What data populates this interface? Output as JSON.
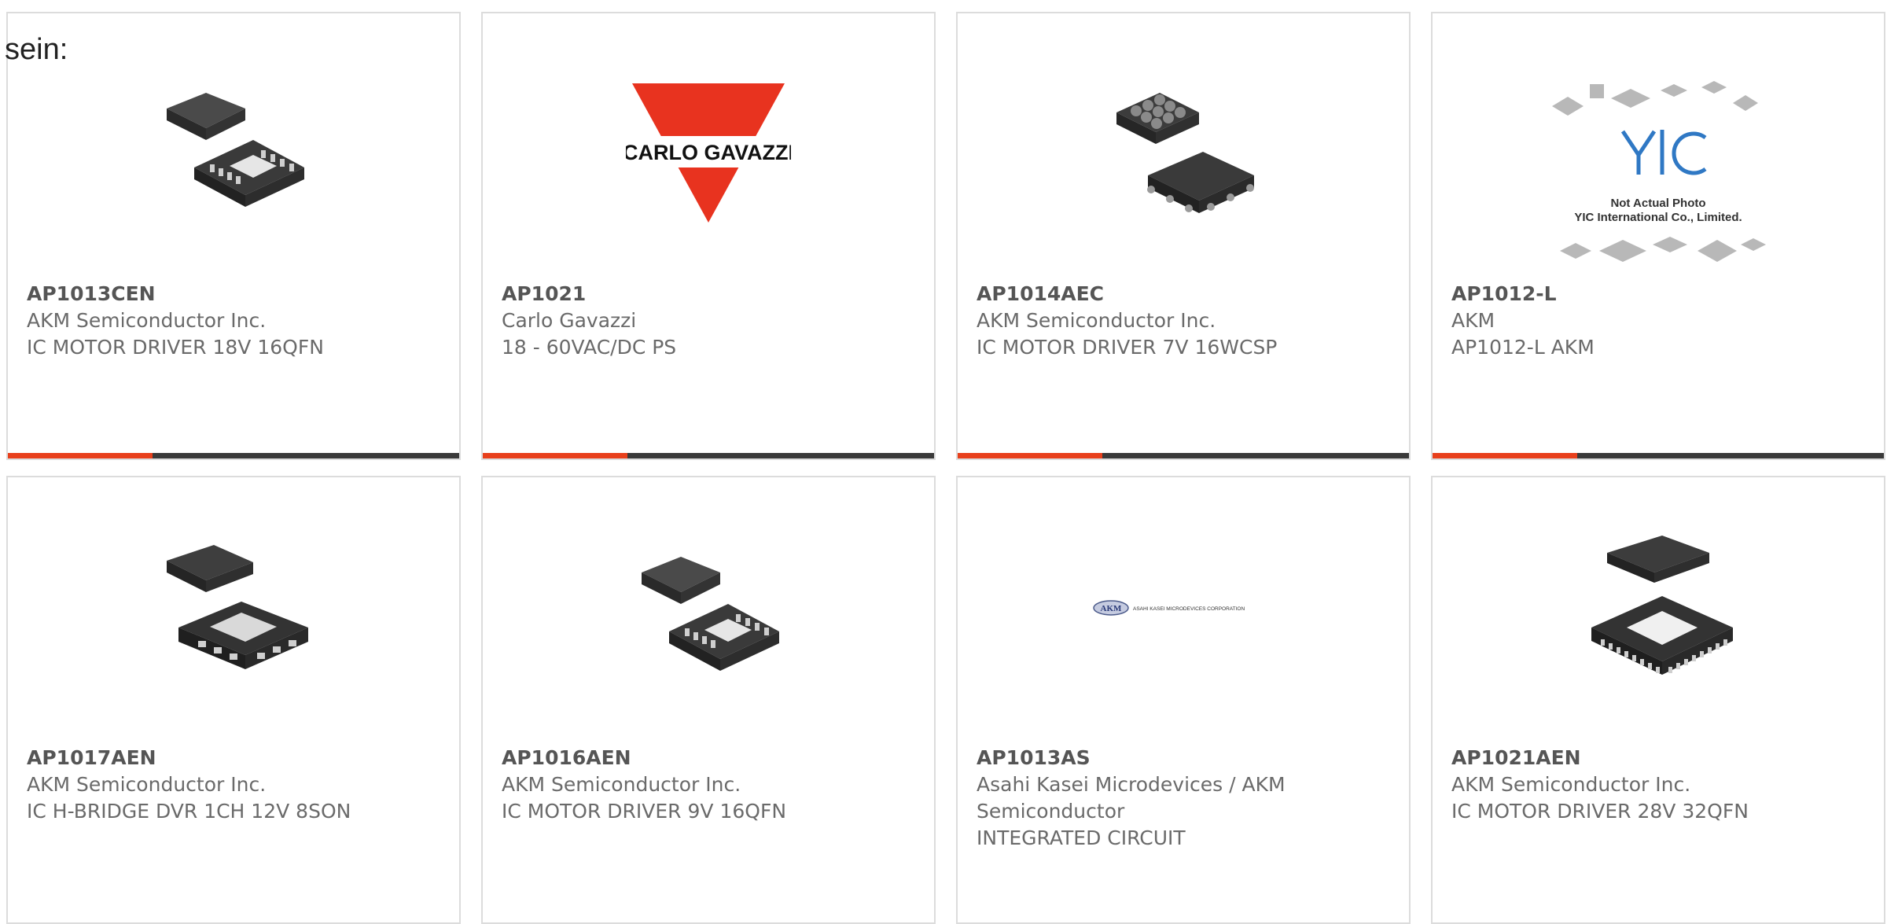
{
  "intro_text": "sein:",
  "colors": {
    "accent": "#e8401c",
    "bar": "#3a3a3a",
    "border": "#dcdcdc",
    "text": "#6a6a6a"
  },
  "cards": [
    {
      "part": "AP1013CEN",
      "maker": "AKM Semiconductor Inc.",
      "desc": "IC MOTOR DRIVER 18V 16QFN",
      "image": "qfn16-chip-icon"
    },
    {
      "part": "AP1021",
      "maker": "Carlo Gavazzi",
      "desc": "18 - 60VAC/DC PS",
      "image": "carlo-gavazzi-logo",
      "logo_text": "CARLO GAVAZZI"
    },
    {
      "part": "AP1014AEC",
      "maker": "AKM Semiconductor Inc.",
      "desc": "IC MOTOR DRIVER 7V 16WCSP",
      "image": "wcsp-chip-icon"
    },
    {
      "part": "AP1012-L",
      "maker": "AKM",
      "desc": "AP1012-L AKM",
      "image": "yic-placeholder",
      "logo_text": "YIC",
      "note1": "Not Actual Photo",
      "note2": "YIC International Co., Limited."
    },
    {
      "part": "AP1017AEN",
      "maker": "AKM Semiconductor Inc.",
      "desc": "IC H-BRIDGE DVR 1CH 12V 8SON",
      "image": "son8-chip-icon"
    },
    {
      "part": "AP1016AEN",
      "maker": "AKM Semiconductor Inc.",
      "desc": "IC MOTOR DRIVER 9V 16QFN",
      "image": "qfn16-chip-icon"
    },
    {
      "part": "AP1013AS",
      "maker": "Asahi Kasei Microdevices / AKM Semiconductor",
      "desc": "INTEGRATED CIRCUIT",
      "image": "akm-logo",
      "logo_text": "AKM",
      "logo_sub": "ASAHI KASEI MICRODEVICES CORPORATION"
    },
    {
      "part": "AP1021AEN",
      "maker": "AKM Semiconductor Inc.",
      "desc": "IC MOTOR DRIVER 28V 32QFN",
      "image": "qfn32-chip-icon"
    }
  ]
}
